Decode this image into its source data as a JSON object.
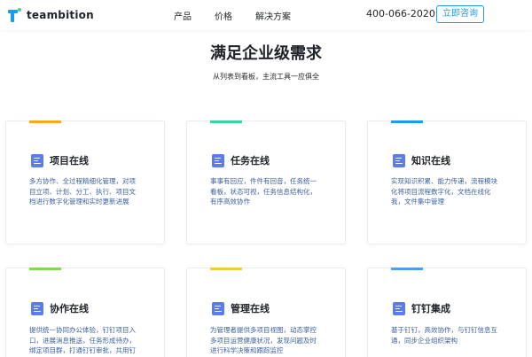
{
  "header": {
    "logo_text": "teambition",
    "nav": [
      "产品",
      "价格",
      "解决方案"
    ],
    "phone": "400-066-2020",
    "consult_label": "立即咨询"
  },
  "main": {
    "title": "满足企业级需求",
    "subtitle": "从列表到看板，主流工具一应俱全"
  },
  "cards": [
    {
      "title": "项目在线",
      "desc": "多方协作、全过程精细化管理，对项目立项、计划、分工、执行、项目文档进行数字化管理和实时更新进展",
      "accent": "#f5a623"
    },
    {
      "title": "任务在线",
      "desc": "事事有回应，件件有回音，任务统一看板，状态可视，任务信息结构化，有序高效协作",
      "accent": "#3ad0a0"
    },
    {
      "title": "知识在线",
      "desc": "实现知识积累、能力传递，流程模块化将项目流程数字化，文档在线化我，文件集中管理",
      "accent": "#1b9aee"
    },
    {
      "title": "协作在线",
      "desc": "提供统一协同办公体验，钉钉项目入口，进展消息推送，任务形成待办，绑定项目群，打通钉钉审批，共用钉钉文档、云盘",
      "accent": "#7ed957"
    },
    {
      "title": "管理在线",
      "desc": "为管理者提供多项目视图，动态掌控多项目运营健康状况，发现问题及时进行科学决策和跟踪监控",
      "accent": "#f5c842"
    },
    {
      "title": "钉钉集成",
      "desc": "基于钉钉，高效协作，与钉钉信息互通，同步企业组织架构",
      "accent": "#4a9ff5"
    }
  ],
  "colors": {
    "brand": "#1b9aee",
    "card_icon": "#5b7bf0",
    "desc_text": "#3a5f9e"
  }
}
